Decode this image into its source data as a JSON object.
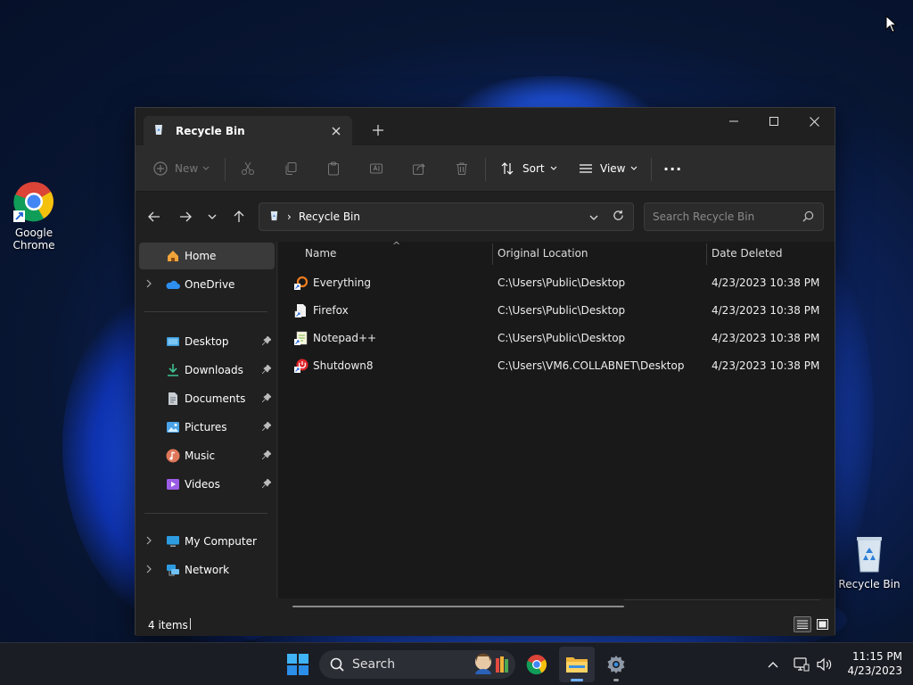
{
  "desktop": {
    "icons": [
      {
        "label_line1": "Google",
        "label_line2": "Chrome",
        "icon": "chrome-icon"
      },
      {
        "label_line1": "Recycle Bin",
        "icon": "recycle-bin-icon"
      }
    ]
  },
  "window": {
    "tab": {
      "title": "Recycle Bin",
      "icon": "recycle-bin-icon"
    },
    "new_tab_symbol": "+",
    "controls": [
      "minimize-icon",
      "maximize-icon",
      "close-icon"
    ],
    "commandbar": {
      "new_label": "New",
      "sort_label": "Sort",
      "view_label": "View",
      "more_symbol": "···"
    },
    "address": {
      "breadcrumb": "Recycle Bin",
      "separator": "›"
    },
    "search": {
      "placeholder": "Search Recycle Bin"
    },
    "nav": {
      "home": "Home",
      "onedrive": "OneDrive",
      "quick_access": [
        {
          "label": "Desktop",
          "icon": "desktop-folder-icon",
          "color": "#3a9bdc"
        },
        {
          "label": "Downloads",
          "icon": "downloads-icon",
          "color": "#3ec28f"
        },
        {
          "label": "Documents",
          "icon": "documents-icon",
          "color": "#9aa3ad"
        },
        {
          "label": "Pictures",
          "icon": "pictures-icon",
          "color": "#4aa3e8"
        },
        {
          "label": "Music",
          "icon": "music-icon",
          "color": "#e0775a"
        },
        {
          "label": "Videos",
          "icon": "videos-icon",
          "color": "#9b5de5"
        }
      ],
      "my_computer": "My Computer",
      "network": "Network"
    },
    "columns": {
      "name": "Name",
      "original_location": "Original Location",
      "date_deleted": "Date Deleted",
      "sort_indicator": "^"
    },
    "rows": [
      {
        "name": "Everything",
        "location": "C:\\Users\\Public\\Desktop",
        "date": "4/23/2023 10:38 PM",
        "icon": "everything-icon"
      },
      {
        "name": "Firefox",
        "location": "C:\\Users\\Public\\Desktop",
        "date": "4/23/2023 10:38 PM",
        "icon": "shortcut-file-icon"
      },
      {
        "name": "Notepad++",
        "location": "C:\\Users\\Public\\Desktop",
        "date": "4/23/2023 10:38 PM",
        "icon": "notepadpp-icon"
      },
      {
        "name": "Shutdown8",
        "location": "C:\\Users\\VM6.COLLABNET\\Desktop",
        "date": "4/23/2023 10:38 PM",
        "icon": "shutdown-icon"
      }
    ],
    "status": {
      "item_count": "4 items"
    }
  },
  "taskbar": {
    "search_label": "Search",
    "clock": {
      "time": "11:15 PM",
      "date": "4/23/2023"
    }
  },
  "colors": {
    "accent": "#60cdff",
    "window_bg": "#202020",
    "content_bg": "#191919",
    "taskbar_bg": "#1b1d24"
  }
}
